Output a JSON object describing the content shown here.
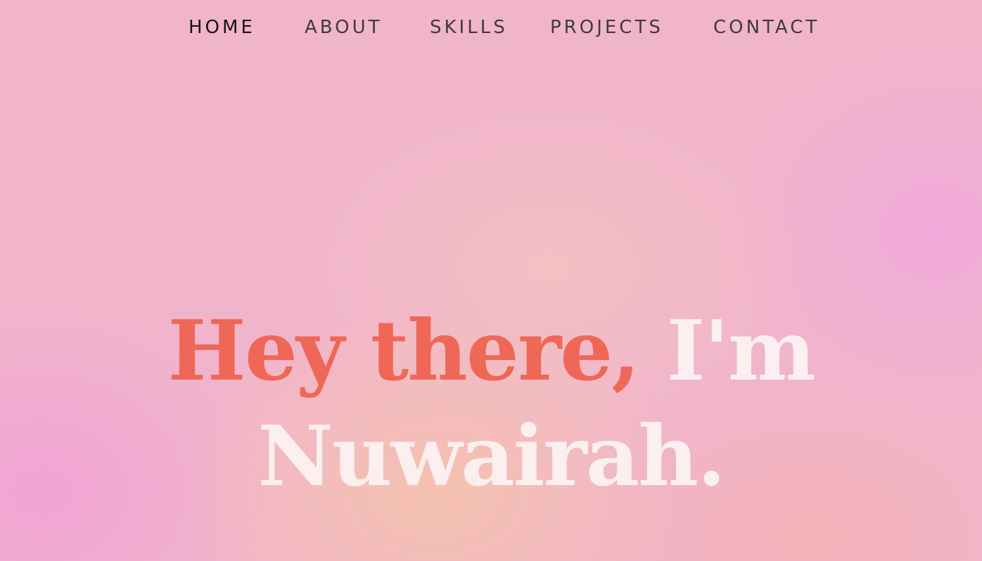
{
  "nav": {
    "items": [
      {
        "label": "HOME",
        "active": true
      },
      {
        "label": "ABOUT",
        "active": false
      },
      {
        "label": "SKILLS",
        "active": false
      },
      {
        "label": "PROJECTS",
        "active": false
      },
      {
        "label": "CONTACT",
        "active": false
      }
    ]
  },
  "hero": {
    "greeting": "Hey there,",
    "intro": "I'm",
    "name": "Nuwairah."
  },
  "colors": {
    "accent": "#ef6757",
    "name_text": "#fbeff0",
    "nav_text": "#3f3a3c",
    "nav_active": "#141214",
    "background": "#f1b5cb"
  }
}
